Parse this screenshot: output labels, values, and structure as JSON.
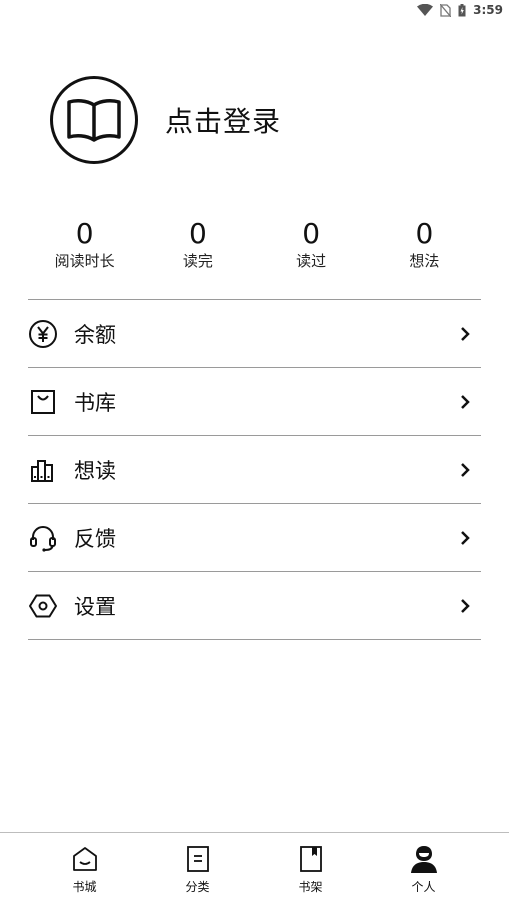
{
  "status_bar": {
    "time": "3:59"
  },
  "profile": {
    "login_label": "点击登录",
    "avatar_icon": "open-book-icon"
  },
  "stats": [
    {
      "value": "0",
      "label": "阅读时长"
    },
    {
      "value": "0",
      "label": "读完"
    },
    {
      "value": "0",
      "label": "读过"
    },
    {
      "value": "0",
      "label": "想法"
    }
  ],
  "menu": [
    {
      "label": "余额",
      "icon": "yen-coin-icon"
    },
    {
      "label": "书库",
      "icon": "bag-icon"
    },
    {
      "label": "想读",
      "icon": "bookshelf-icon"
    },
    {
      "label": "反馈",
      "icon": "headset-icon"
    },
    {
      "label": "设置",
      "icon": "hexagon-settings-icon"
    }
  ],
  "bottom_nav": [
    {
      "label": "书城",
      "icon": "store-icon",
      "active": false
    },
    {
      "label": "分类",
      "icon": "category-icon",
      "active": false
    },
    {
      "label": "书架",
      "icon": "bookmark-book-icon",
      "active": false
    },
    {
      "label": "个人",
      "icon": "person-icon",
      "active": true
    }
  ]
}
